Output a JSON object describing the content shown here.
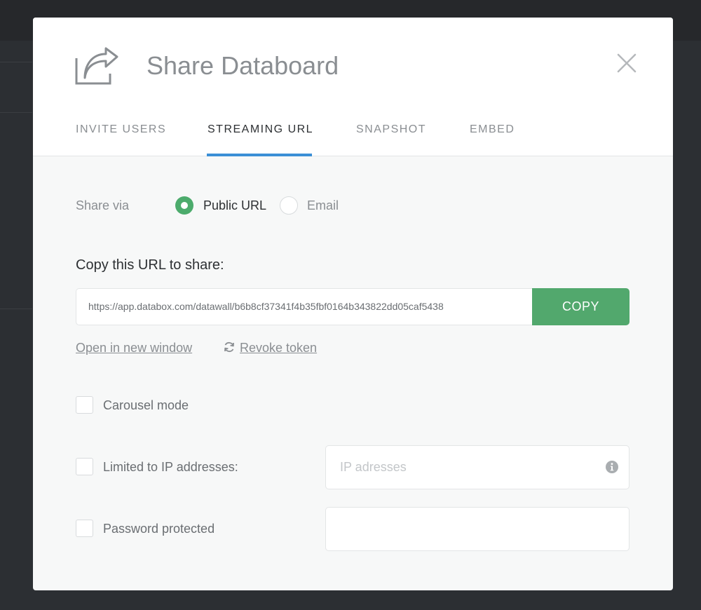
{
  "modal": {
    "title": "Share Databoard",
    "icons": {
      "share": "share-arrow-icon",
      "close": "close-icon"
    }
  },
  "tabs": [
    {
      "label": "INVITE USERS",
      "active": false
    },
    {
      "label": "STREAMING URL",
      "active": true
    },
    {
      "label": "SNAPSHOT",
      "active": false
    },
    {
      "label": "EMBED",
      "active": false
    }
  ],
  "share_via": {
    "label": "Share via",
    "options": [
      {
        "label": "Public URL",
        "selected": true
      },
      {
        "label": "Email",
        "selected": false
      }
    ]
  },
  "url_section": {
    "heading": "Copy this URL to share:",
    "url": "https://app.databox.com/datawall/b6b8cf37341f4b35fbf0164b343822dd05caf5438",
    "copy_label": "COPY",
    "open_link": "Open in new window",
    "revoke_link": "Revoke token"
  },
  "options": {
    "carousel": {
      "label": "Carousel mode",
      "checked": false
    },
    "ip_limit": {
      "label": "Limited to IP addresses:",
      "checked": false,
      "placeholder": "IP adresses",
      "value": ""
    },
    "password": {
      "label": "Password protected",
      "checked": false,
      "value": ""
    }
  },
  "colors": {
    "accent_green": "#52a86d",
    "tab_underline": "#3b8fd6",
    "overlay": "#2c2f33"
  }
}
